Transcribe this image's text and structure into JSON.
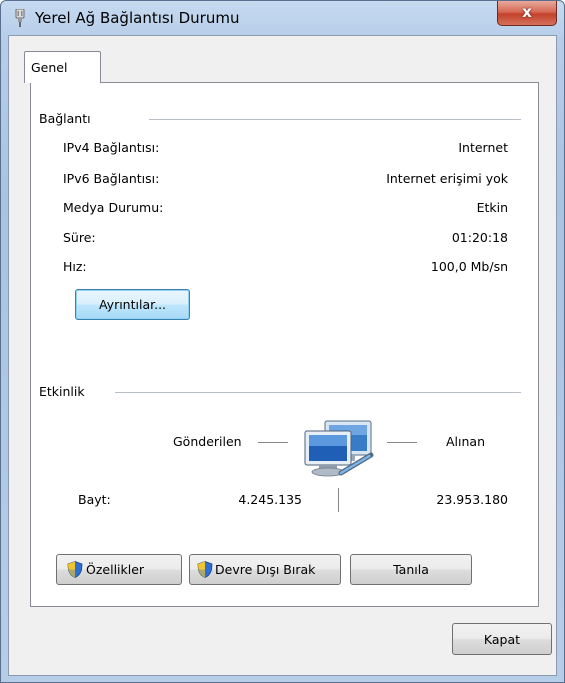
{
  "window": {
    "title": "Yerel Ağ Bağlantısı Durumu",
    "close_label": "x"
  },
  "tabs": [
    {
      "label": "Genel"
    }
  ],
  "connection": {
    "group_label": "Bağlantı",
    "rows": [
      {
        "label": "IPv4 Bağlantısı:",
        "value": "Internet"
      },
      {
        "label": "IPv6 Bağlantısı:",
        "value": "Internet erişimi yok"
      },
      {
        "label": "Medya Durumu:",
        "value": "Etkin"
      },
      {
        "label": "Süre:",
        "value": "01:20:18"
      },
      {
        "label": "Hız:",
        "value": "100,0 Mb/sn"
      }
    ],
    "details_button": "Ayrıntılar..."
  },
  "activity": {
    "group_label": "Etkinlik",
    "sent_label": "Gönderilen",
    "received_label": "Alınan",
    "bytes_label": "Bayt:",
    "bytes_sent": "4.245.135",
    "bytes_received": "23.953.180"
  },
  "buttons": {
    "properties": "Özellikler",
    "disable": "Devre Dışı Bırak",
    "diagnose": "Tanıla",
    "close": "Kapat"
  },
  "icons": {
    "title": "network-plug-icon",
    "network": "network-computers-icon",
    "shield": "uac-shield-icon"
  }
}
